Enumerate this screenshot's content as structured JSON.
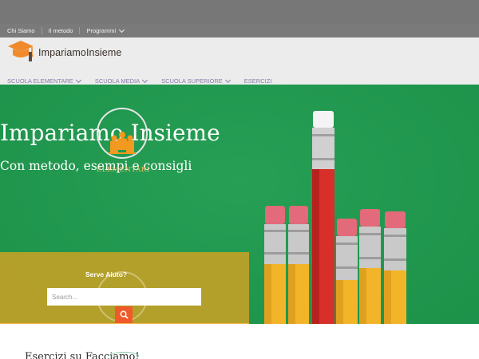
{
  "topbar": {
    "items": [
      {
        "label": "Chi Siamo",
        "has_dropdown": false
      },
      {
        "label": "Il metodo",
        "has_dropdown": false
      },
      {
        "label": "Programmi",
        "has_dropdown": true
      }
    ]
  },
  "header": {
    "logo_text": "ImpariamoInsieme",
    "nav": [
      {
        "label": "SCUOLA ELEMENTARE",
        "has_dropdown": true
      },
      {
        "label": "SCUOLA MEDIA",
        "has_dropdown": true
      },
      {
        "label": "SCUOLA SUPERIORE",
        "has_dropdown": true
      },
      {
        "label": "ESERCIZI",
        "has_dropdown": false
      }
    ]
  },
  "hero": {
    "title": "Impariamo Insieme",
    "subtitle": "Con metodo, esempi e consigli",
    "category_label": "ELEMENTARI"
  },
  "help": {
    "title": "Serve Aiuto?",
    "search_placeholder": "Search..."
  },
  "section": {
    "heading": "Esercizi su Facciamo!"
  },
  "colors": {
    "hero_green": "#1e9b4e",
    "help_gold": "#bea028",
    "search_button": "#ef5a2a",
    "logo_orange": "#f08a2c",
    "nav_text": "#8b7aa8"
  },
  "icons": {
    "logo": "graduation-cap-icon",
    "search": "search-icon",
    "dropdown": "chevron-down-icon",
    "category": "children-group-icon"
  }
}
